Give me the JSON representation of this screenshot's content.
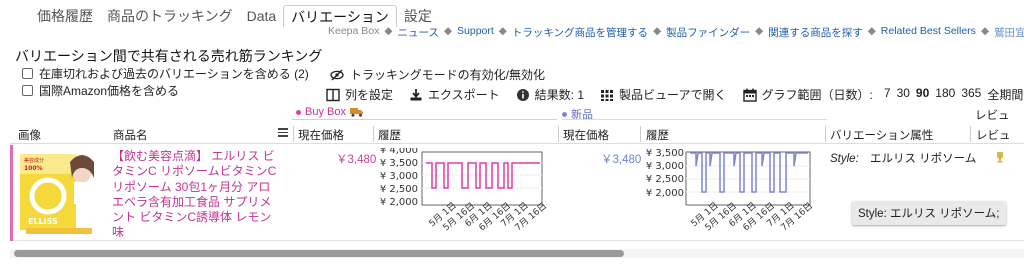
{
  "tabs": [
    {
      "label": "価格履歴"
    },
    {
      "label": "商品のトラッキング"
    },
    {
      "label": "Data"
    },
    {
      "label": "バリエーション",
      "active": true
    },
    {
      "label": "設定"
    }
  ],
  "top_links": {
    "brand": "Keepa Box",
    "items": [
      "ニュース",
      "Support",
      "トラッキング商品を管理する",
      "製品ファインダー",
      "関連する商品を探す",
      "Related Best Sellers"
    ],
    "separator": "◆",
    "user": "鷲田宜彦"
  },
  "heading": "バリエーション間で共有される売れ筋ランキング",
  "options": {
    "include_oos": "在庫切れおよび過去のバリエーションを含める (2)",
    "intl_prices": "国際Amazon価格を含める"
  },
  "tracking_toggle": "トラッキングモードの有効化/無効化",
  "toolbar": {
    "columns": "列を設定",
    "export": "エクスポート",
    "results": "結果数: 1",
    "viewer": "製品ビューアで開く",
    "range_label": "グラフ範囲（日数）:",
    "range_options": [
      "7",
      "30",
      "90",
      "180",
      "365",
      "全期間"
    ],
    "range_selected": "90"
  },
  "groups": {
    "buybox": "Buy Box",
    "new": "新品"
  },
  "columns": {
    "image": "画像",
    "name": "商品名",
    "current_price_1": "現在価格",
    "history_1": "履歴",
    "current_price_2": "現在価格",
    "history_2": "履歴",
    "variation": "バリエーション属性",
    "review_top": "レビュ",
    "review": "レビュ"
  },
  "product": {
    "name": "【飲む美容点滴】 エルリス ビタミンC リポソームビタミンC リポソーム 30包1ヶ月分 アロエベラ含有加工食品 サプリメント ビタミンC誘導体 レモン味",
    "buybox_price": "￥3,480",
    "new_price": "￥3,480",
    "variation_key": "Style:",
    "variation_value": "エルリス リポソーム"
  },
  "chart_ticks": {
    "y": [
      "¥ 3,500",
      "¥ 3,000",
      "¥ 2,500",
      "¥ 2,000"
    ],
    "y_buybox": [
      "¥ 4,000",
      "¥ 3,500",
      "¥ 3,000",
      "¥ 2,500",
      "¥ 2,000"
    ],
    "x": [
      "5月 1日",
      "5月 16日",
      "6月 1日",
      "6月 16日",
      "7月 1日",
      "7月 16日"
    ]
  },
  "tooltip": "Style: エルリス リポソーム;",
  "colors": {
    "buybox": "#e53ba5",
    "new": "#7f86d6",
    "link": "#1f5fa8"
  }
}
